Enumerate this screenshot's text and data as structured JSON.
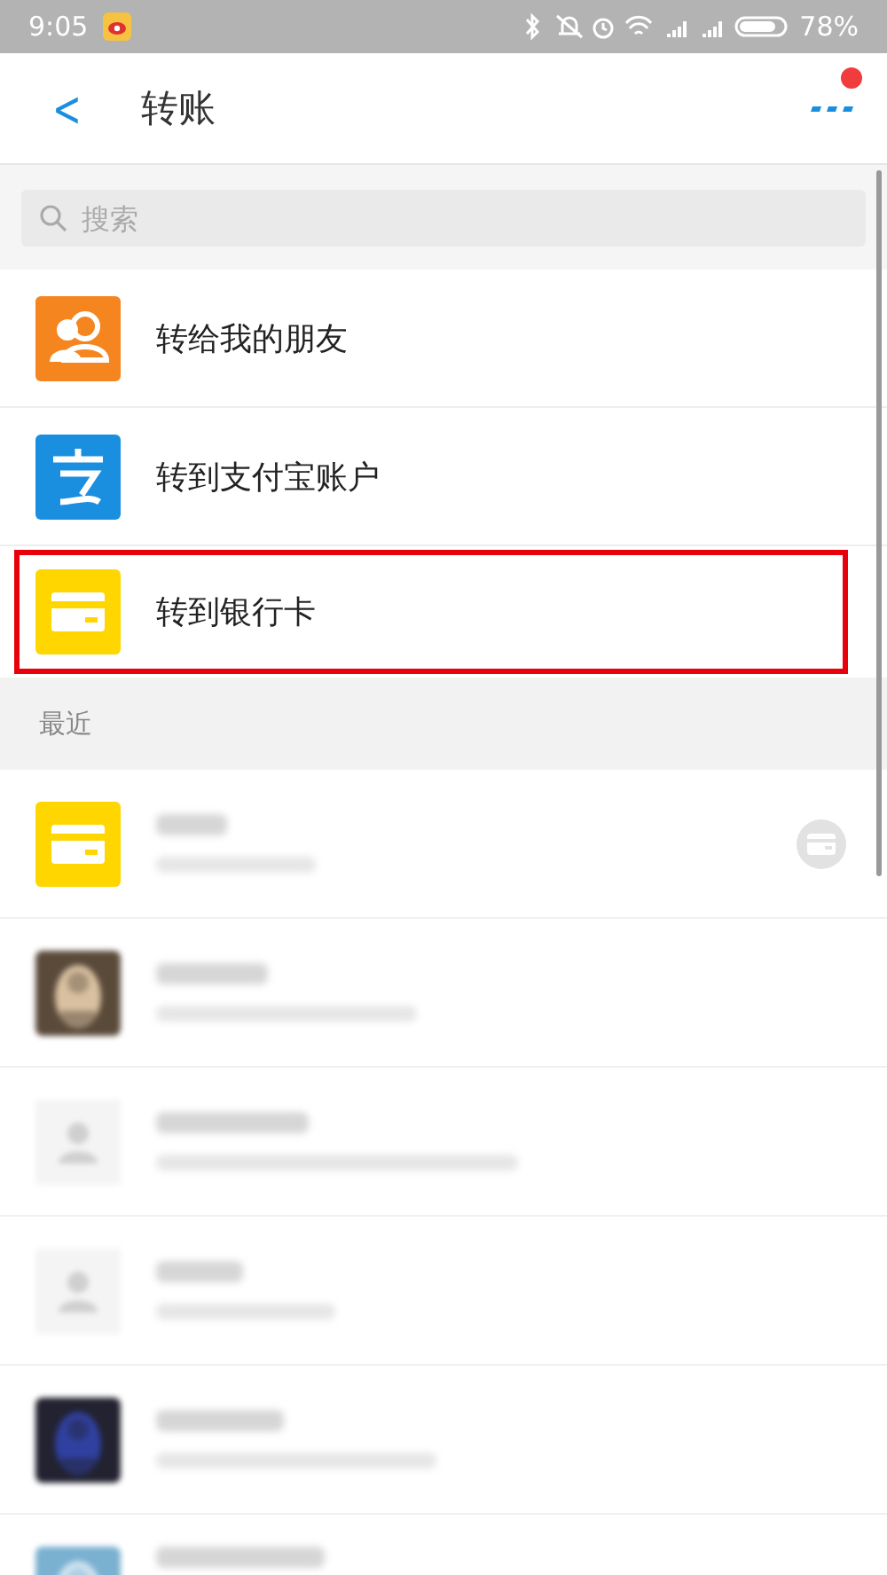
{
  "status_bar": {
    "time": "9:05",
    "battery": "78%"
  },
  "header": {
    "title": "转账",
    "back_icon": "<",
    "notification_dot": true
  },
  "search": {
    "placeholder": "搜索"
  },
  "options": [
    {
      "kind": "friends",
      "label": "转给我的朋友",
      "highlighted": false
    },
    {
      "kind": "alipay",
      "label": "转到支付宝账户",
      "highlighted": false
    },
    {
      "kind": "bank",
      "label": "转到银行卡",
      "highlighted": true
    }
  ],
  "recent": {
    "title": "最近",
    "items": [
      {
        "kind": "card",
        "card_action": true
      },
      {
        "kind": "photo_light",
        "card_action": false
      },
      {
        "kind": "default",
        "card_action": false
      },
      {
        "kind": "default",
        "card_action": false
      },
      {
        "kind": "photo_dark",
        "card_action": false
      },
      {
        "kind": "photo_blue",
        "card_action": false
      }
    ]
  }
}
